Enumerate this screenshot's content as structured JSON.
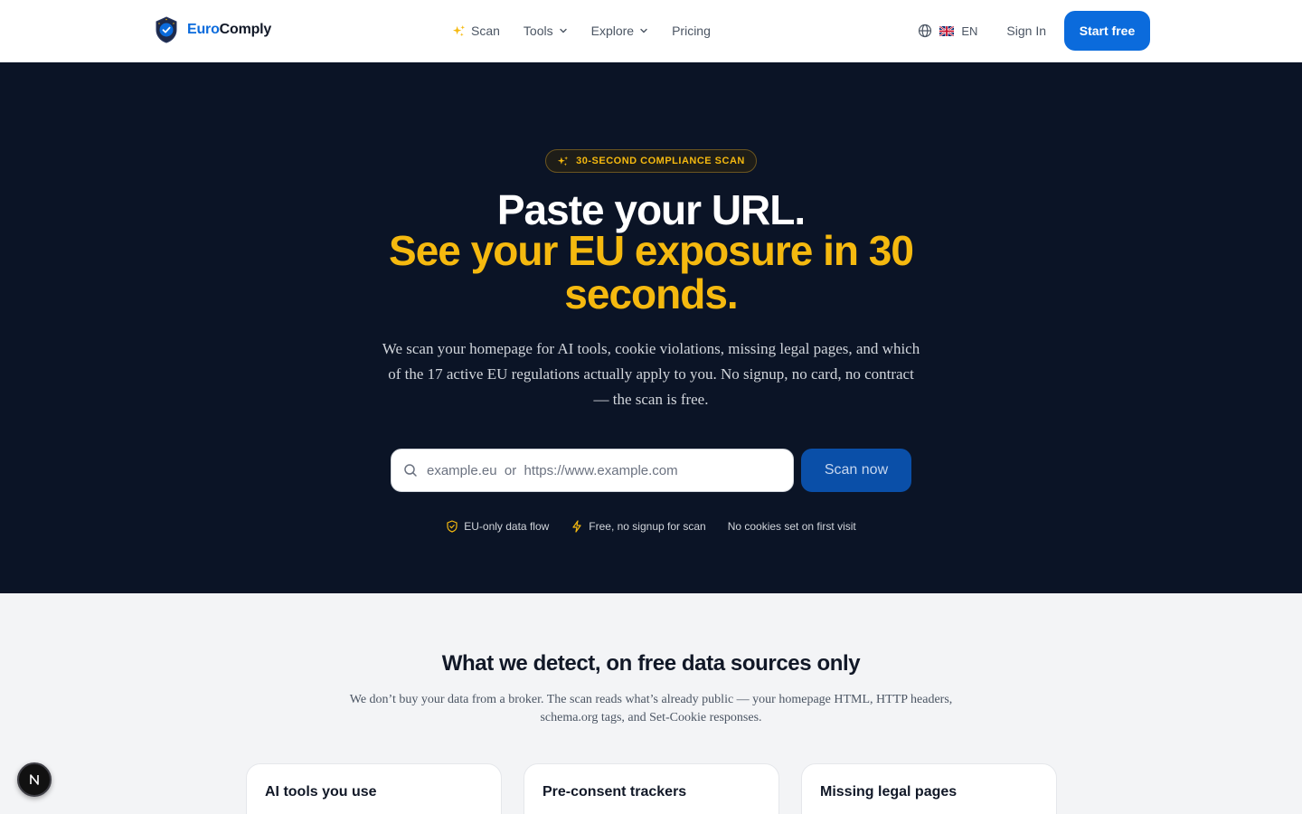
{
  "brand": {
    "name_part1": "Euro",
    "name_part2": "Comply"
  },
  "nav": {
    "items": [
      {
        "label": "Scan",
        "icon": "sparkles-icon",
        "dropdown": false
      },
      {
        "label": "Tools",
        "icon": "chevron-down-icon",
        "dropdown": true
      },
      {
        "label": "Explore",
        "icon": "chevron-down-icon",
        "dropdown": true
      },
      {
        "label": "Pricing",
        "dropdown": false
      }
    ]
  },
  "header": {
    "language": "EN",
    "sign_in": "Sign In",
    "start_free": "Start free"
  },
  "hero": {
    "badge": "30-SECOND COMPLIANCE SCAN",
    "title_line1": "Paste your URL.",
    "title_line2": "See your EU exposure in 30 seconds.",
    "description": "We scan your homepage for AI tools, cookie violations, missing legal pages, and which of the 17 active EU regulations actually apply to you. No signup, no card, no contract — the scan is free.",
    "search_placeholder": "example.eu  or  https://www.example.com",
    "search_value": "",
    "scan_button": "Scan now",
    "trust": [
      {
        "label": "EU-only data flow",
        "icon": "shield-check-icon"
      },
      {
        "label": "Free, no signup for scan",
        "icon": "lightning-icon"
      },
      {
        "label": "No cookies set on first visit"
      }
    ]
  },
  "detect": {
    "title": "What we detect, on free data sources only",
    "description": "We don’t buy your data from a broker. The scan reads what’s already public — your homepage HTML, HTTP headers, schema.org tags, and Set-Cookie responses.",
    "cards": [
      {
        "title": "AI tools you use"
      },
      {
        "title": "Pre-consent trackers"
      },
      {
        "title": "Missing legal pages"
      }
    ]
  },
  "colors": {
    "accent": "#0b6bdc",
    "hero_bg": "#0b1426",
    "highlight": "#f5b90f",
    "scan_button": "#0a4fa8"
  },
  "dev_badge": "N"
}
